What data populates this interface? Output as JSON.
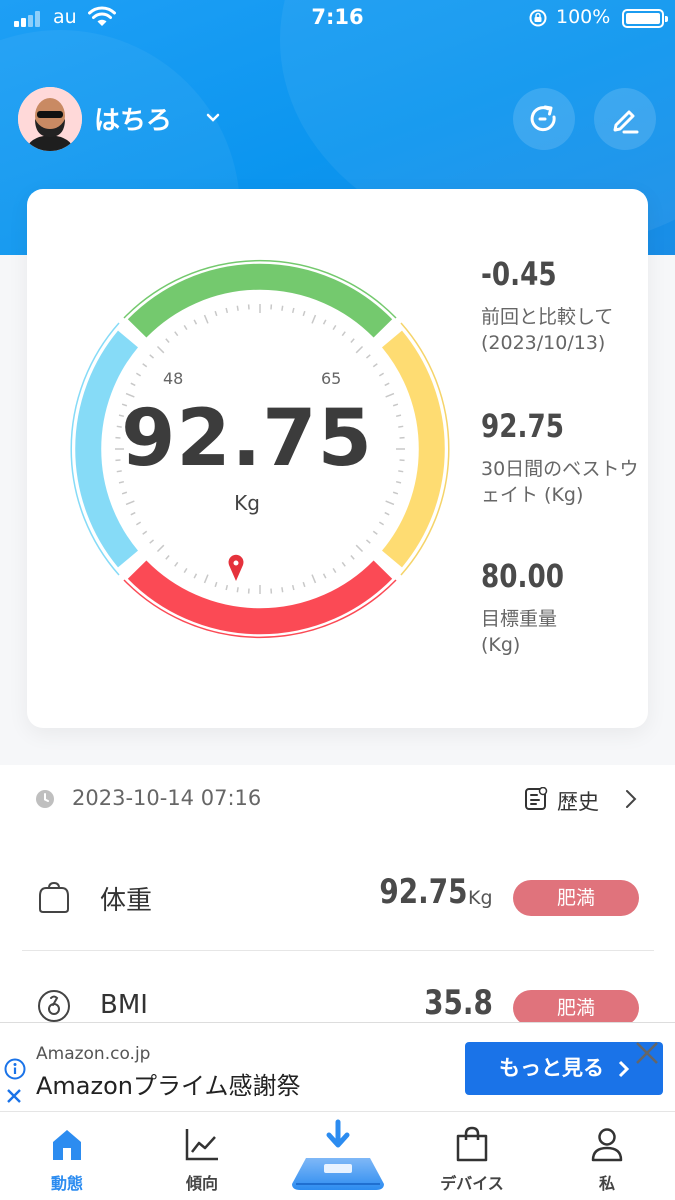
{
  "status_bar": {
    "carrier": "au",
    "time": "7:16",
    "battery": "100%"
  },
  "profile": {
    "name": "はちろ"
  },
  "gauge": {
    "value": "92.75",
    "unit": "Kg",
    "tick_left": "48",
    "tick_right": "65",
    "indicator_segment": "red",
    "colors": {
      "green": "#74c96e",
      "yellow": "#fedc72",
      "red": "#fb4a55",
      "blue": "#86dbf7"
    }
  },
  "stats": [
    {
      "value": "-0.45",
      "label": "前回と比較して (2023/10/13)"
    },
    {
      "value": "92.75",
      "label": "30日間のベストウェイト (Kg)"
    },
    {
      "value": "80.00",
      "label": "目標重量 (Kg)"
    }
  ],
  "record": {
    "datetime": "2023-10-14 07:16",
    "history_label": "歴史"
  },
  "metrics": [
    {
      "icon": "weight-icon",
      "label": "体重",
      "value": "92.75",
      "unit": "Kg",
      "status": "肥満"
    },
    {
      "icon": "bmi-icon",
      "label": "BMI",
      "value": "35.8",
      "unit": "",
      "status": "肥満"
    }
  ],
  "ad": {
    "domain": "Amazon.co.jp",
    "title": "Amazonプライム感謝祭",
    "cta": "もっと見る"
  },
  "tabs": [
    {
      "label": "動態",
      "icon": "home-icon",
      "active": true
    },
    {
      "label": "傾向",
      "icon": "trend-chart-icon",
      "active": false
    },
    {
      "label": "",
      "icon": "scale-download-icon",
      "active": false
    },
    {
      "label": "デバイス",
      "icon": "shopping-bag-icon",
      "active": false
    },
    {
      "label": "私",
      "icon": "person-icon",
      "active": false
    }
  ],
  "accent_color": "#2c8cf0",
  "badge_color": "#e0737c"
}
